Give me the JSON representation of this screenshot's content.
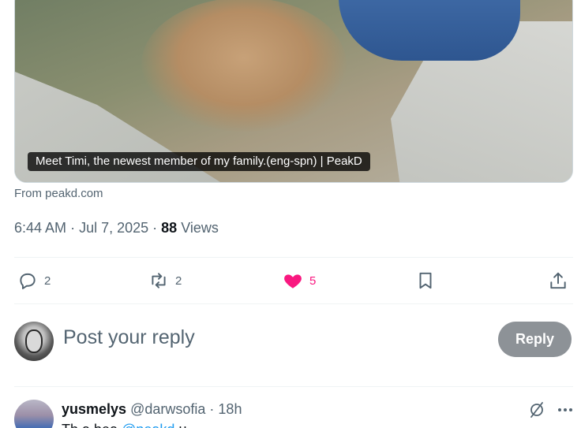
{
  "card": {
    "caption": "Meet Timi, the newest member of my family.(eng-spn) | PeakD",
    "source": "From peakd.com"
  },
  "meta": {
    "time": "6:44 AM",
    "date": "Jul 7, 2025",
    "views_count": "88",
    "views_label": "Views"
  },
  "actions": {
    "replies": "2",
    "reposts": "2",
    "likes": "5",
    "like_color": "#f91880"
  },
  "reply_box": {
    "placeholder": "Post your reply",
    "button_label": "Reply"
  },
  "reply_tweet": {
    "name": "yusmelys",
    "handle": "@darwsofia",
    "time": "18h",
    "text_start": "Th",
    "text_partial": "a bea",
    "mention_partial": "@peakd",
    "text_rest": "u"
  }
}
